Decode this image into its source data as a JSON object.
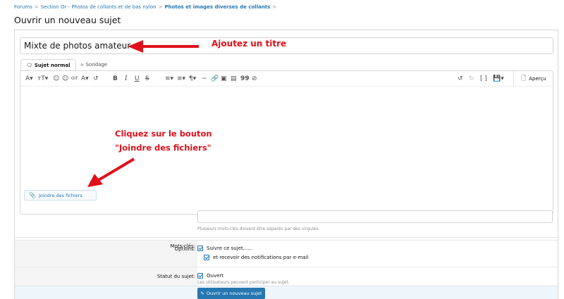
{
  "breadcrumb": {
    "items": [
      "Forums",
      "Section Or - Photos de collants et de bas nylon",
      "Photos et images diverses de collants"
    ],
    "separator": ">"
  },
  "page": {
    "title": "Ouvrir un nouveau sujet"
  },
  "form": {
    "title_value": "Mixte de photos amateur",
    "tabs": [
      {
        "label": "Sujet normal",
        "icon": "comments-icon",
        "active": true
      },
      {
        "label": "Sondage",
        "icon": "bar-chart-icon",
        "active": false
      }
    ],
    "toolbar": {
      "items": [
        "A",
        "ᴛT",
        "☺",
        "☺",
        "GIF",
        "A",
        "↺",
        "B",
        "I",
        "U",
        "S",
        "≡",
        "≡",
        "¶",
        "≡",
        "🔗",
        "▣",
        "▤",
        "99",
        "👁"
      ],
      "right_items": [
        "↺",
        "↻",
        "[ ]",
        "💾"
      ],
      "preview_label": "Aperçu"
    },
    "attach_label": "Joindre des fichiers",
    "keywords": {
      "label": "Mots-clés:",
      "hint": "Plusieurs mots-clés doivent être séparés par des virgules."
    },
    "options": {
      "label": "Options:",
      "watch_label": "Suivre ce sujet......",
      "email_label": "et recevoir des notifications par e-mail"
    },
    "status": {
      "label": "Statut du sujet:",
      "open_label": "Ouvert",
      "hint": "Les utilisateurs peuvent participer au sujet."
    },
    "submit_label": "Ouvrir un nouveau sujet"
  },
  "annotations": {
    "title_hint": "Ajoutez un titre",
    "attach_hint_line1": "Cliquez sur le bouton",
    "attach_hint_line2": "\"Joindre des fichiers\""
  },
  "colors": {
    "accent": "#2577b1",
    "annotation": "#e0101a",
    "panel": "#f5f5f5"
  }
}
